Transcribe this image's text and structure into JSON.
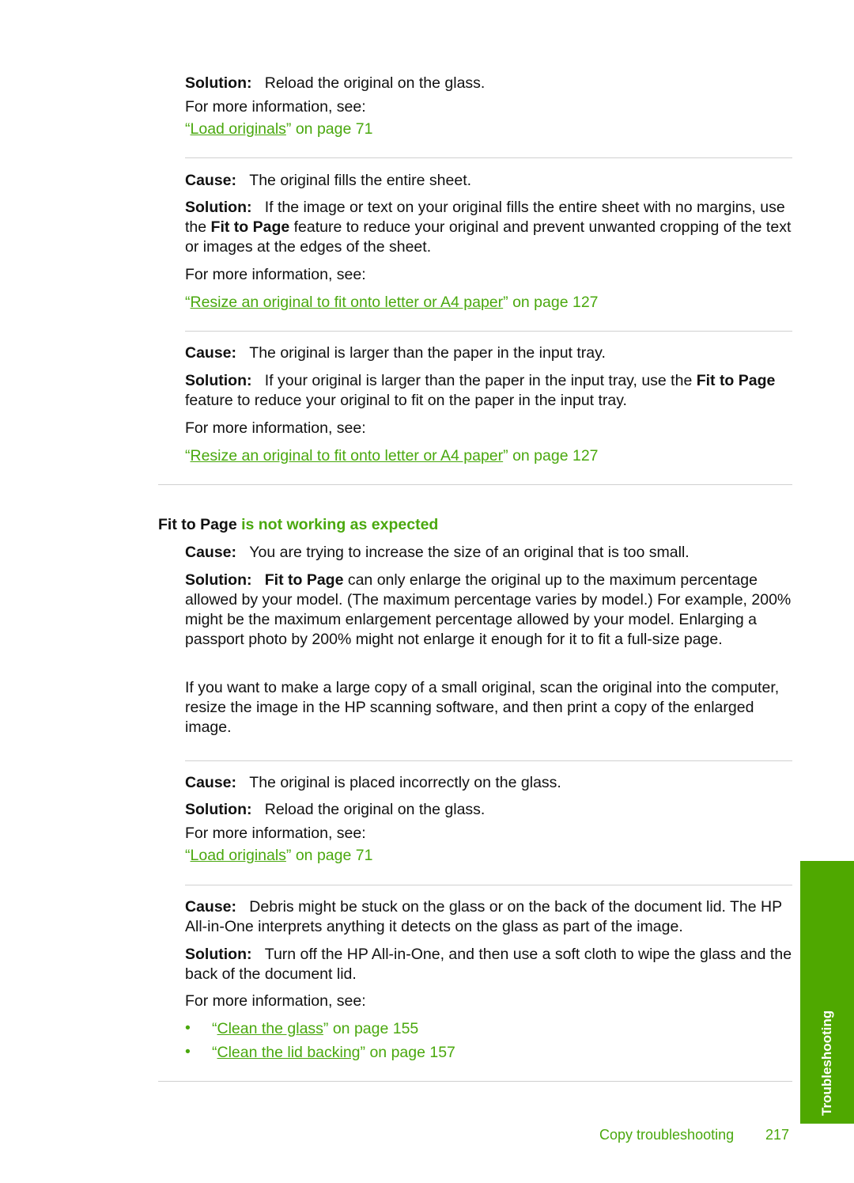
{
  "sections": [
    {
      "solution": {
        "label": "Solution:",
        "text": "Reload the original on the glass."
      },
      "more_info": "For more information, see:",
      "link": {
        "open": "“",
        "title": "Load originals",
        "close": "” on page 71"
      }
    },
    {
      "cause": {
        "label": "Cause:",
        "text": "The original fills the entire sheet."
      },
      "solution": {
        "label": "Solution:",
        "text_a": "If the image or text on your original fills the entire sheet with no margins, use the ",
        "bold": "Fit to Page",
        "text_b": " feature to reduce your original and prevent unwanted cropping of the text or images at the edges of the sheet."
      },
      "more_info": "For more information, see:",
      "link": {
        "open": "“",
        "title": "Resize an original to fit onto letter or A4 paper",
        "close": "” on page 127"
      }
    },
    {
      "cause": {
        "label": "Cause:",
        "text": "The original is larger than the paper in the input tray."
      },
      "solution": {
        "label": "Solution:",
        "text_a": "If your original is larger than the paper in the input tray, use the ",
        "bold": "Fit to Page",
        "text_b": " feature to reduce your original to fit on the paper in the input tray."
      },
      "more_info": "For more information, see:",
      "link": {
        "open": "“",
        "title": "Resize an original to fit onto letter or A4 paper",
        "close": "” on page 127"
      }
    }
  ],
  "heading": {
    "bold": "Fit to Page",
    "rest": " is not working as expected"
  },
  "sections2": [
    {
      "cause": {
        "label": "Cause:",
        "text": "You are trying to increase the size of an original that is too small."
      },
      "solution": {
        "label": "Solution:",
        "bold": "Fit to Page",
        "text": " can only enlarge the original up to the maximum percentage allowed by your model. (The maximum percentage varies by model.) For example, 200% might be the maximum enlargement percentage allowed by your model. Enlarging a passport photo by 200% might not enlarge it enough for it to fit a full-size page."
      },
      "para": "If you want to make a large copy of a small original, scan the original into the computer, resize the image in the HP scanning software, and then print a copy of the enlarged image."
    },
    {
      "cause": {
        "label": "Cause:",
        "text": "The original is placed incorrectly on the glass."
      },
      "solution": {
        "label": "Solution:",
        "text": "Reload the original on the glass."
      },
      "more_info": "For more information, see:",
      "link": {
        "open": "“",
        "title": "Load originals",
        "close": "” on page 71"
      }
    },
    {
      "cause": {
        "label": "Cause:",
        "text": "Debris might be stuck on the glass or on the back of the document lid. The HP All-in-One interprets anything it detects on the glass as part of the image."
      },
      "solution": {
        "label": "Solution:",
        "text": "Turn off the HP All-in-One, and then use a soft cloth to wipe the glass and the back of the document lid."
      },
      "more_info": "For more information, see:",
      "links": [
        {
          "bullet": "•",
          "open": "“",
          "title": "Clean the glass",
          "close": "” on page 155"
        },
        {
          "bullet": "•",
          "open": "“",
          "title": "Clean the lid backing",
          "close": "” on page 157"
        }
      ]
    }
  ],
  "side_tab": "Troubleshooting",
  "footer": {
    "section": "Copy troubleshooting",
    "page": "217"
  }
}
